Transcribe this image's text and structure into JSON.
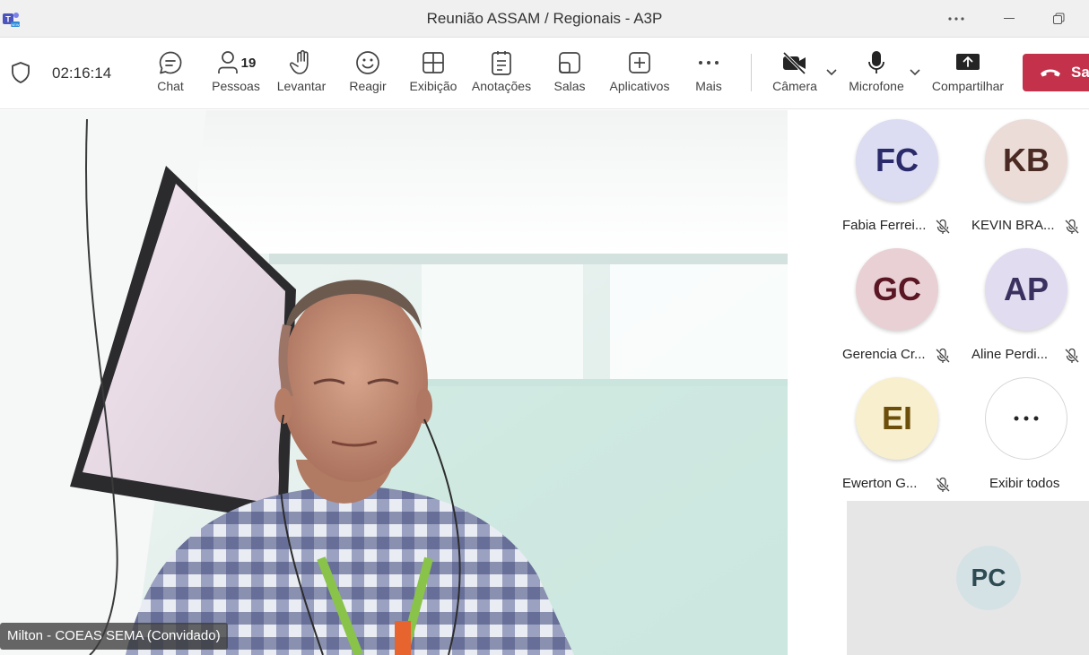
{
  "window": {
    "title": "Reunião ASSAM / Regionais - A3P",
    "app_icon": "teams-icon"
  },
  "toolbar": {
    "timer": "02:16:14",
    "buttons": {
      "chat": "Chat",
      "people": "Pessoas",
      "people_count": "19",
      "raise": "Levantar",
      "react": "Reagir",
      "view": "Exibição",
      "notes": "Anotações",
      "rooms": "Salas",
      "apps": "Aplicativos",
      "more": "Mais",
      "camera": "Câmera",
      "mic": "Microfone",
      "share": "Compartilhar",
      "leave": "Sa"
    },
    "leave_color": "#c4314b"
  },
  "main_video": {
    "participant_name": "Milton - COEAS SEMA (Convidado)"
  },
  "participants": [
    {
      "initials": "FC",
      "name": "Fabia Ferrei...",
      "bg": "#dcdcf2",
      "fg": "#2b2b6b",
      "muted": true
    },
    {
      "initials": "KB",
      "name": "KEVIN BRA...",
      "bg": "#ebdcd8",
      "fg": "#4a2a22",
      "muted": true
    },
    {
      "initials": "GC",
      "name": "Gerencia Cr...",
      "bg": "#e9d0d4",
      "fg": "#5a1622",
      "muted": true
    },
    {
      "initials": "AP",
      "name": "Aline Perdi...",
      "bg": "#e2dcf0",
      "fg": "#3b3160",
      "muted": true
    },
    {
      "initials": "EI",
      "name": "Ewerton G...",
      "bg": "#f8efcf",
      "fg": "#6b4e0a",
      "muted": true
    }
  ],
  "show_all": {
    "label": "Exibir todos",
    "icon": "ellipsis-icon"
  },
  "pinned_tile": {
    "initials": "PC"
  }
}
